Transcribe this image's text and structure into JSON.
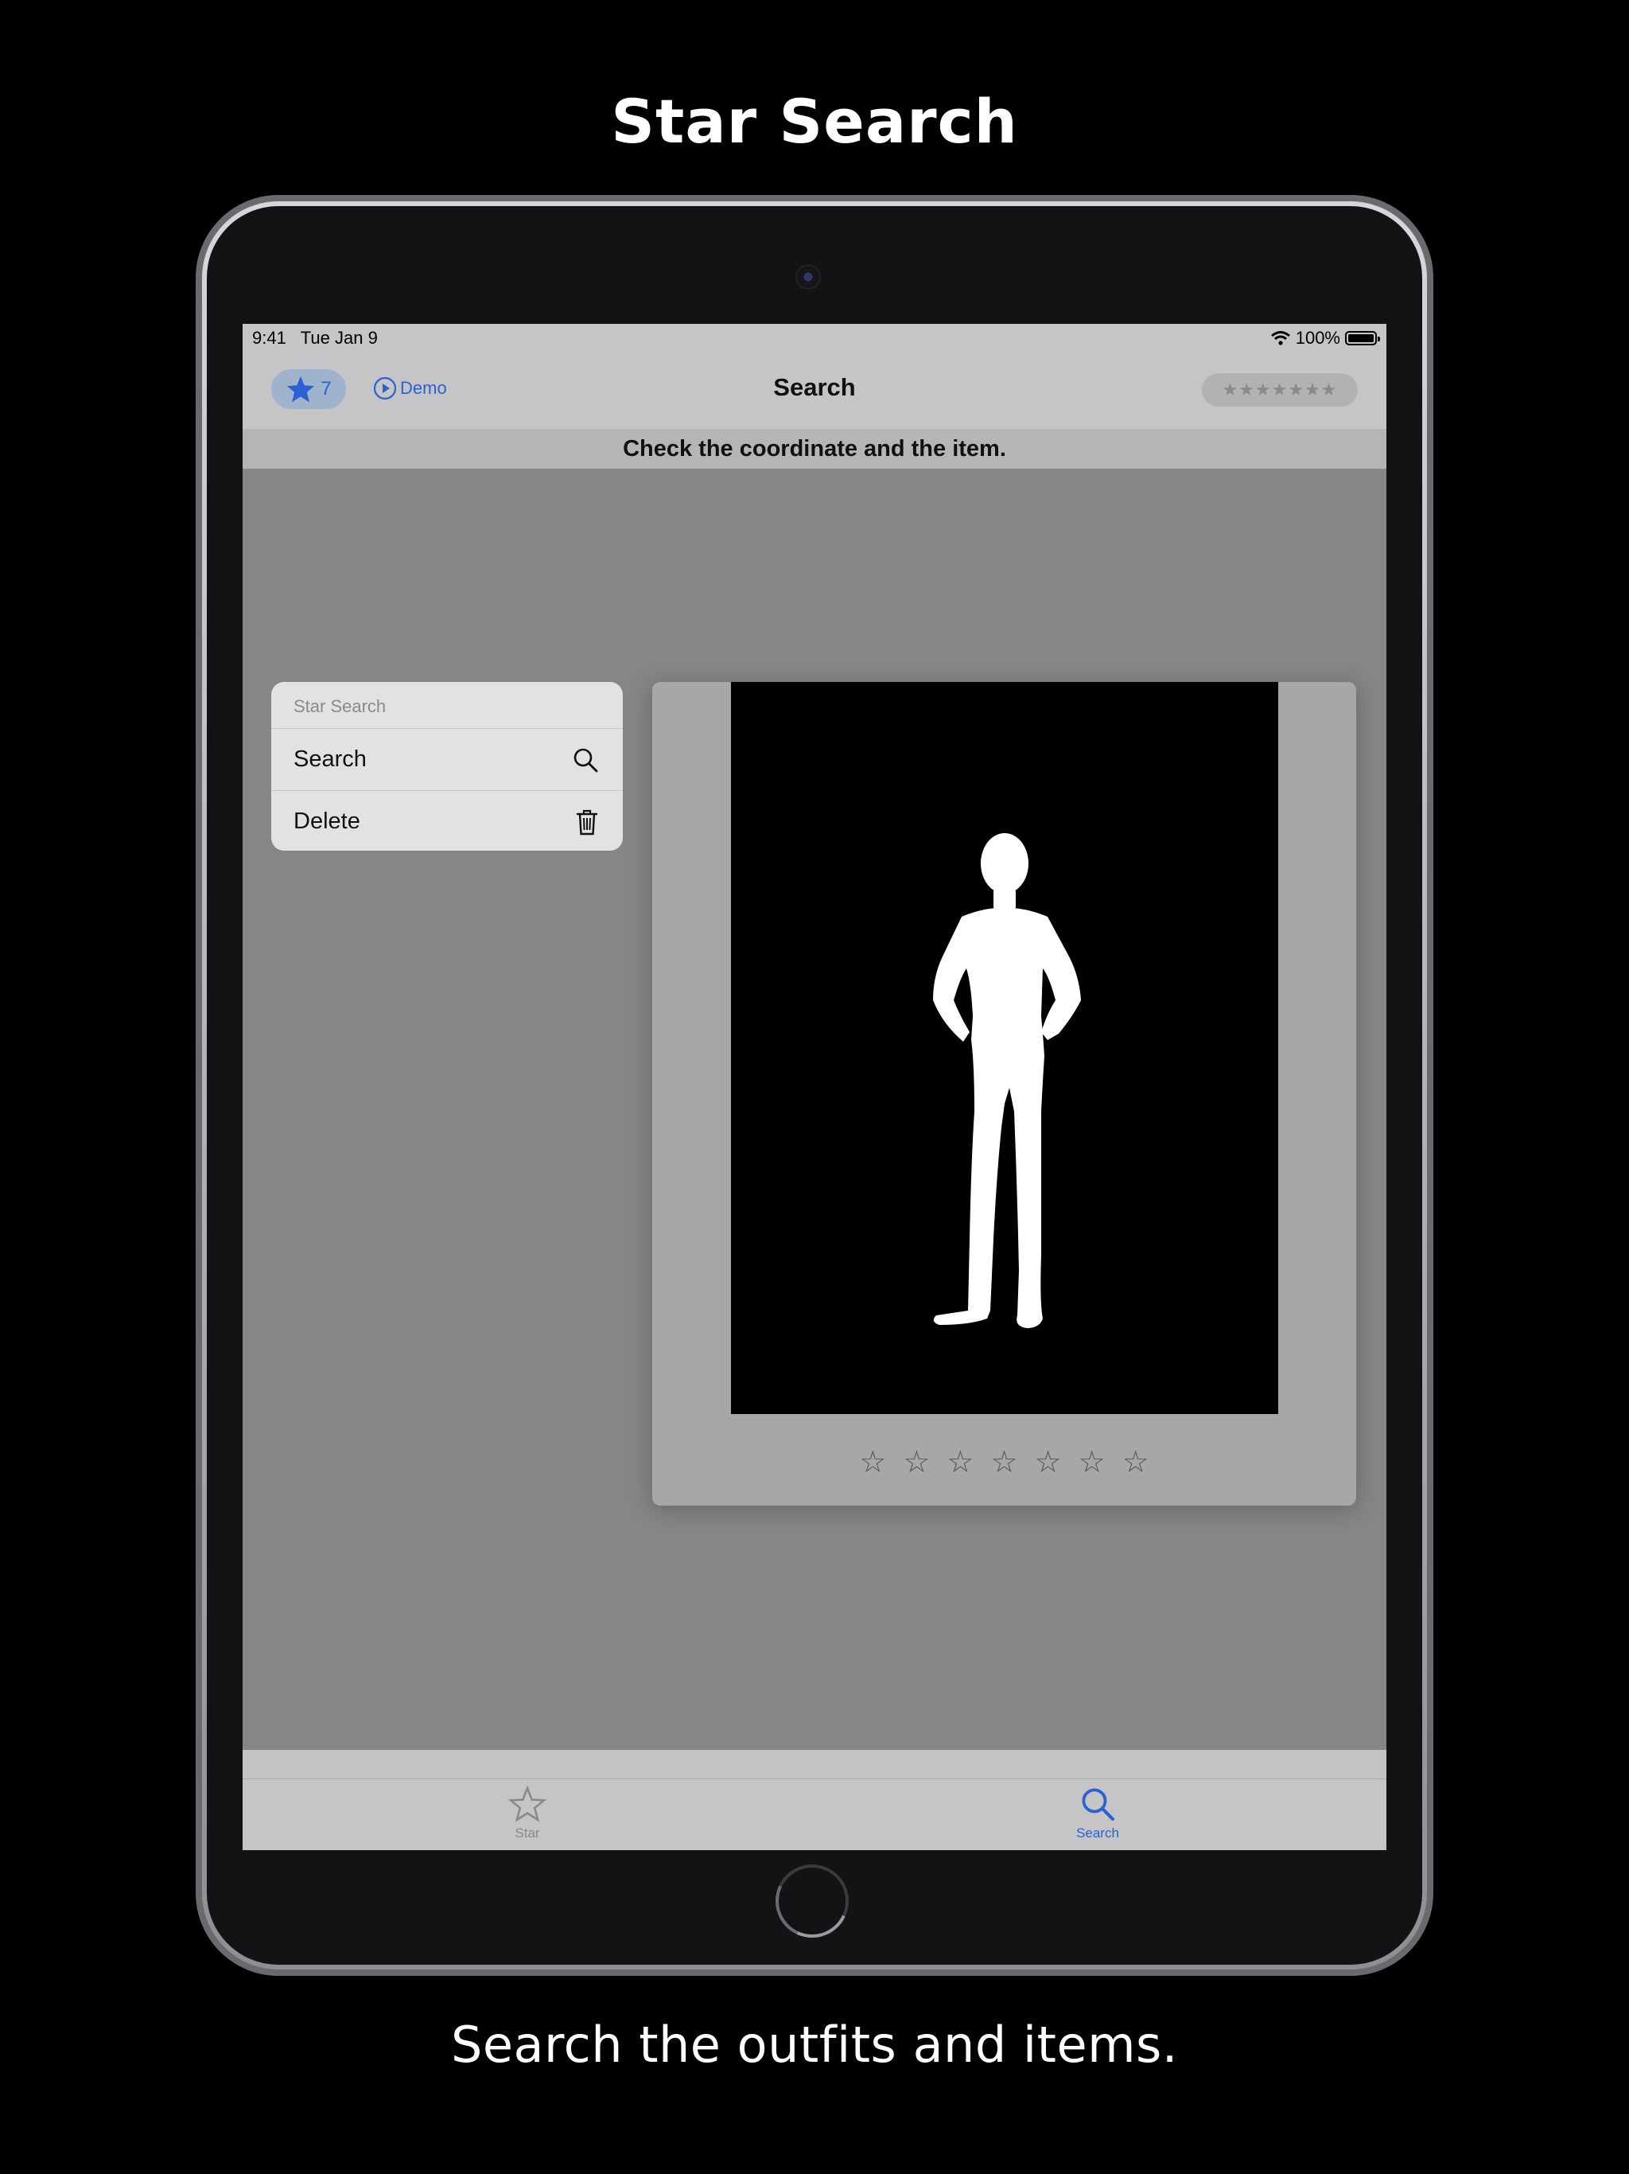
{
  "headline": "Star Search",
  "caption": "Search the outfits and items.",
  "status_bar": {
    "time": "9:41",
    "date": "Tue Jan 9",
    "battery": "100%"
  },
  "nav": {
    "star_count": "7",
    "demo_label": "Demo",
    "title": "Search",
    "rating_placeholder": "★★★★★★★"
  },
  "banner": "Check the coordinate and the item.",
  "menu": {
    "header": "Star Search",
    "items": [
      {
        "label": "Search",
        "icon": "search-icon"
      },
      {
        "label": "Delete",
        "icon": "trash-icon"
      }
    ]
  },
  "card": {
    "image": "person-silhouette",
    "rating": {
      "value": 0,
      "max": 7,
      "glyphs": "☆☆☆☆☆☆☆"
    }
  },
  "tabs": [
    {
      "label": "Star",
      "icon": "star-icon",
      "selected": false
    },
    {
      "label": "Search",
      "icon": "search-icon",
      "selected": true
    }
  ],
  "colors": {
    "accent": "#2a62d3",
    "screen_bg": "#868686",
    "bar_bg": "#c5c5c7"
  }
}
